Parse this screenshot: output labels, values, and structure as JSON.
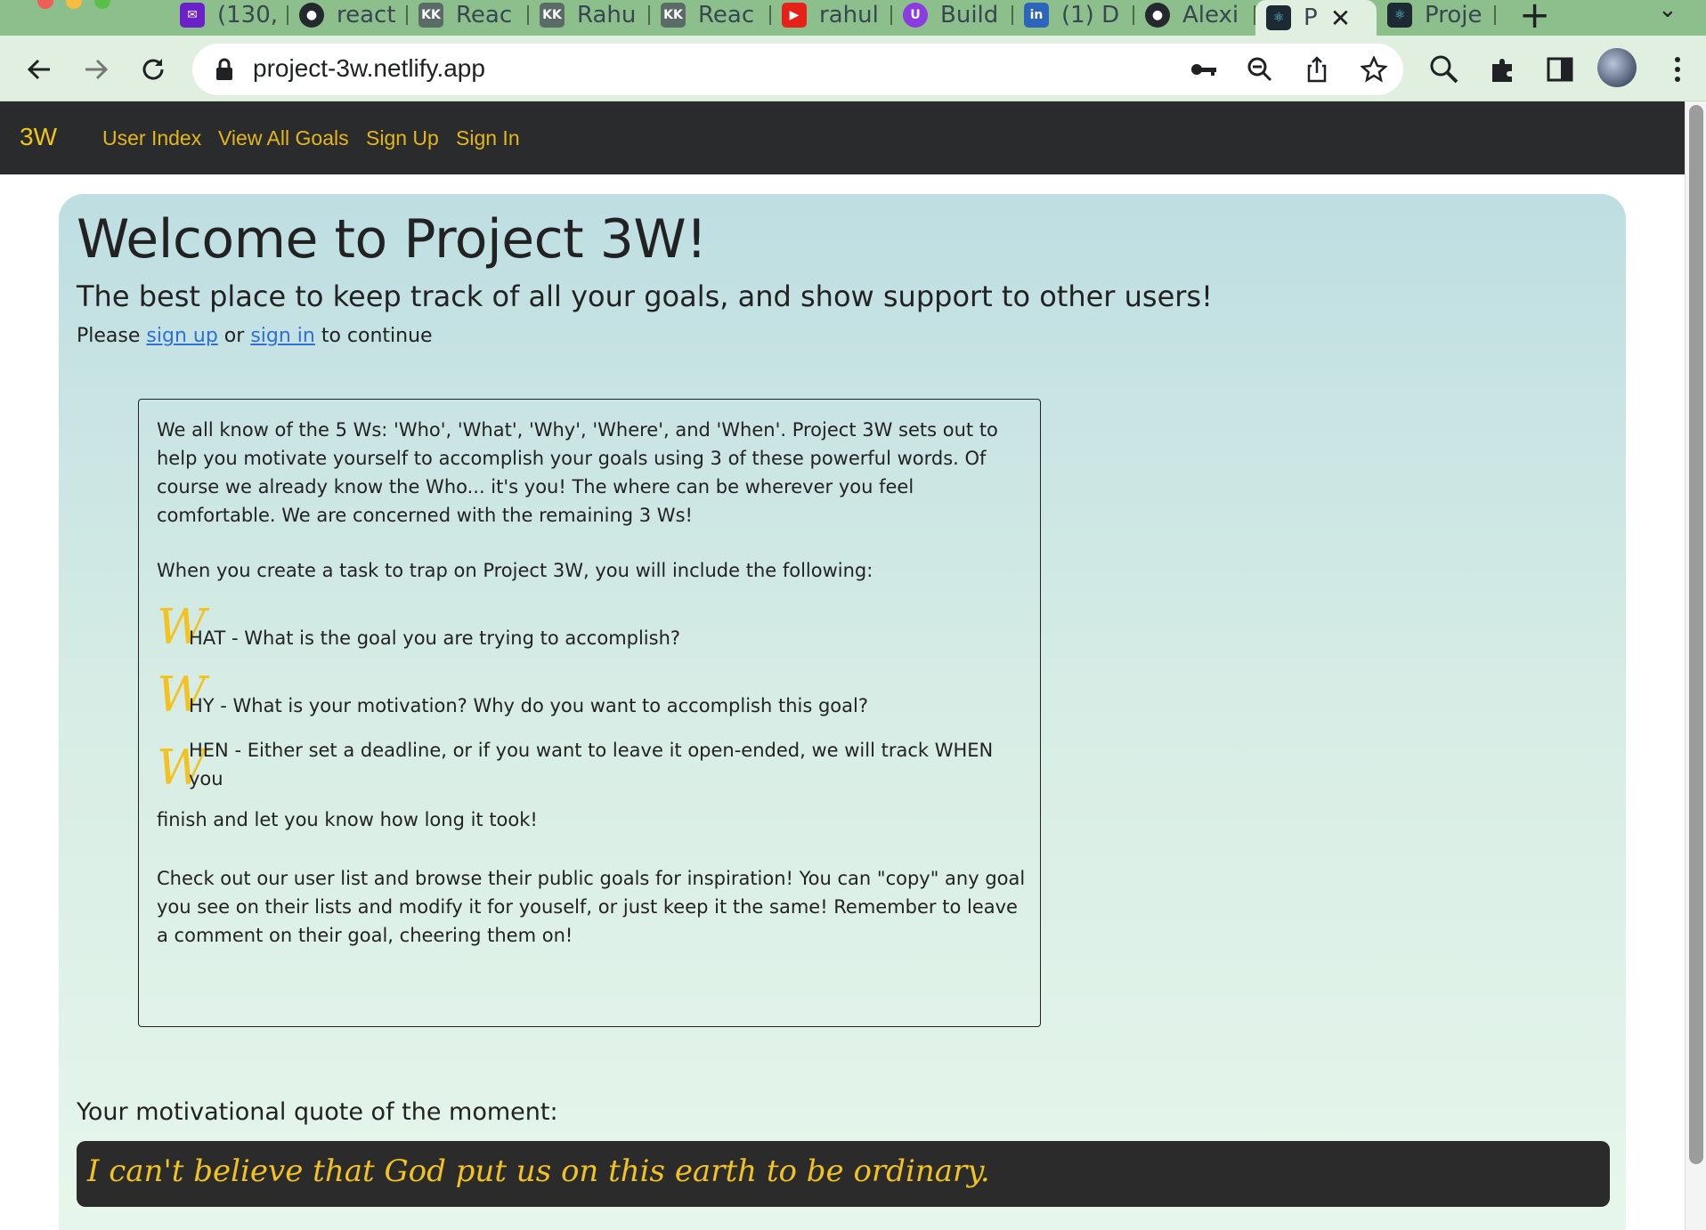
{
  "browser": {
    "tabs": [
      {
        "label": "(130,",
        "icon": "mail-icon"
      },
      {
        "label": "react",
        "icon": "github-icon"
      },
      {
        "label": "Reac",
        "icon": "kk-icon"
      },
      {
        "label": "Rahu",
        "icon": "kk-icon"
      },
      {
        "label": "Reac",
        "icon": "kk-icon"
      },
      {
        "label": "rahul",
        "icon": "youtube-icon"
      },
      {
        "label": "Build",
        "icon": "udemy-icon"
      },
      {
        "label": "(1) D",
        "icon": "linkedin-icon"
      },
      {
        "label": "Alexi",
        "icon": "github-icon"
      },
      {
        "label": "P",
        "icon": "react-icon",
        "active": true
      },
      {
        "label": "Proje",
        "icon": "react-icon"
      }
    ],
    "url": "project-3w.netlify.app",
    "accent": "#8dbf8d"
  },
  "nav": {
    "brand": "3W",
    "links": [
      "User Index",
      "View All Goals",
      "Sign Up",
      "Sign In"
    ],
    "background": "#2a2b2d",
    "link_color": "#e4b719"
  },
  "hero": {
    "title": "Welcome to Project 3W!",
    "subtitle": "The best place to keep track of all your goals, and show support to other users!",
    "please_prefix": "Please",
    "signup_link": "sign up",
    "or_text": "or",
    "signin_link": "sign in",
    "please_suffix": "to continue"
  },
  "about": {
    "intro": "We all know of the 5 Ws: 'Who', 'What', 'Why', 'Where', and 'When'. Project 3W sets out to help you motivate yourself to accomplish your goals using 3 of these powerful words. Of course we already know the Who... it's you! The where can be wherever you feel comfortable. We are concerned with the remaining 3 Ws!",
    "create_line": "When you create a task to trap on Project 3W, you will include the following:",
    "w_letter": "W",
    "what": "HAT - What is the goal you are trying to accomplish?",
    "why": "HY - What is your motivation? Why do you want to accomplish this goal?",
    "when_a": "HEN - Either set a deadline, or if you want to leave it open-ended, we will track WHEN you",
    "when_b": "finish and let you know how long it took!",
    "outro": "Check out our user list and browse their public goals for inspiration! You can \"copy\" any goal you see on their lists and modify it for youself, or just keep it the same! Remember to leave a comment on their goal, cheering them on!"
  },
  "quote": {
    "label": "Your motivational quote of the moment:",
    "text": "I can't believe that God put us on this earth to be ordinary."
  }
}
